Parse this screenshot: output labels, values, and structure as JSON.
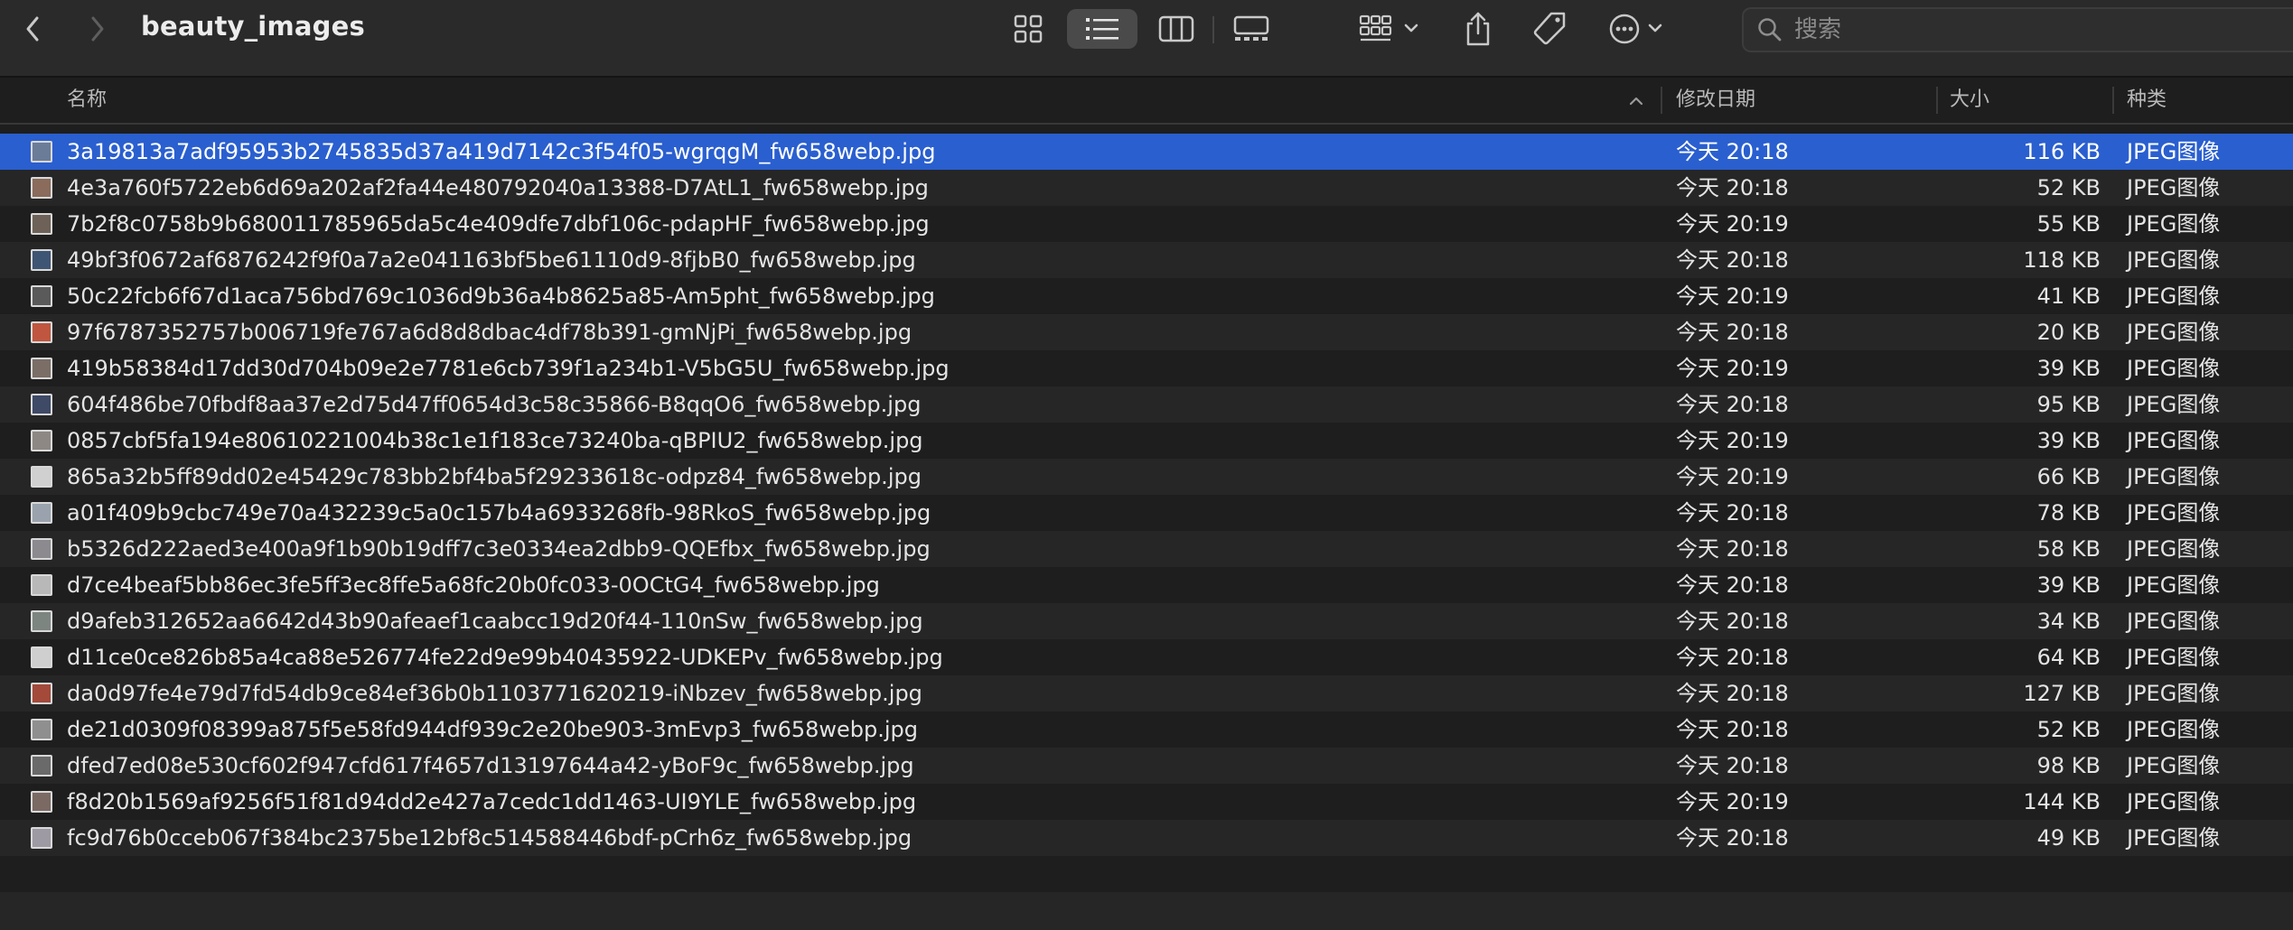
{
  "window": {
    "title": "beauty_images"
  },
  "toolbar": {
    "icons": [
      "chevron-left-icon",
      "chevron-right-icon",
      "icon-view-grid-icon",
      "list-view-icon",
      "column-view-icon",
      "gallery-view-icon",
      "group-icon",
      "share-icon",
      "tag-icon",
      "more-icon"
    ],
    "active_view": "list"
  },
  "search": {
    "placeholder": "搜索",
    "value": ""
  },
  "columns": {
    "name": "名称",
    "date": "修改日期",
    "size": "大小",
    "kind": "种类",
    "sort": "ascending-by-name"
  },
  "colors": {
    "selected_row": "#2a5fcf",
    "background": "#1e1e1e",
    "alt_row": "#262626"
  },
  "files": [
    {
      "name": "3a19813a7adf95953b2745835d37a419d7142c3f54f05-wgrqgM_fw658webp.jpg",
      "date": "今天 20:18",
      "size": "116 KB",
      "kind": "JPEG图像",
      "thumb": "#6b7c99"
    },
    {
      "name": "4e3a760f5722eb6d69a202af2fa44e480792040a13388-D7AtL1_fw658webp.jpg",
      "date": "今天 20:18",
      "size": "52 KB",
      "kind": "JPEG图像",
      "thumb": "#8a6b5c"
    },
    {
      "name": "7b2f8c0758b9b680011785965da5c4e409dfe7dbf106c-pdapHF_fw658webp.jpg",
      "date": "今天 20:19",
      "size": "55 KB",
      "kind": "JPEG图像",
      "thumb": "#6e6258"
    },
    {
      "name": "49bf3f0672af6876242f9f0a7a2e041163bf5be61110d9-8fjbB0_fw658webp.jpg",
      "date": "今天 20:18",
      "size": "118 KB",
      "kind": "JPEG图像",
      "thumb": "#3f5574"
    },
    {
      "name": "50c22fcb6f67d1aca756bd769c1036d9b36a4b8625a85-Am5pht_fw658webp.jpg",
      "date": "今天 20:19",
      "size": "41 KB",
      "kind": "JPEG图像",
      "thumb": "#5a5a5a"
    },
    {
      "name": "97f6787352757b006719fe767a6d8d8dbac4df78b391-gmNjPi_fw658webp.jpg",
      "date": "今天 20:18",
      "size": "20 KB",
      "kind": "JPEG图像",
      "thumb": "#c0563f"
    },
    {
      "name": "419b58384d17dd30d704b09e2e7781e6cb739f1a234b1-V5bG5U_fw658webp.jpg",
      "date": "今天 20:19",
      "size": "39 KB",
      "kind": "JPEG图像",
      "thumb": "#7a6e66"
    },
    {
      "name": "604f486be70fbdf8aa37e2d75d47ff0654d3c58c35866-B8qqO6_fw658webp.jpg",
      "date": "今天 20:18",
      "size": "95 KB",
      "kind": "JPEG图像",
      "thumb": "#3e4a66"
    },
    {
      "name": "0857cbf5fa194e80610221004b38c1e1f183ce73240ba-qBPIU2_fw658webp.jpg",
      "date": "今天 20:19",
      "size": "39 KB",
      "kind": "JPEG图像",
      "thumb": "#8e8884"
    },
    {
      "name": "865a32b5ff89dd02e45429c783bb2bf4ba5f29233618c-odpz84_fw658webp.jpg",
      "date": "今天 20:19",
      "size": "66 KB",
      "kind": "JPEG图像",
      "thumb": "#d0d0d0"
    },
    {
      "name": "a01f409b9cbc749e70a432239c5a0c157b4a6933268fb-98RkoS_fw658webp.jpg",
      "date": "今天 20:18",
      "size": "78 KB",
      "kind": "JPEG图像",
      "thumb": "#9aa3ad"
    },
    {
      "name": "b5326d222aed3e400a9f1b90b19dff7c3e0334ea2dbb9-QQEfbx_fw658webp.jpg",
      "date": "今天 20:18",
      "size": "58 KB",
      "kind": "JPEG图像",
      "thumb": "#8c8a8f"
    },
    {
      "name": "d7ce4beaf5bb86ec3fe5ff3ec8ffe5a68fc20b0fc033-0OCtG4_fw658webp.jpg",
      "date": "今天 20:18",
      "size": "39 KB",
      "kind": "JPEG图像",
      "thumb": "#b8b8b8"
    },
    {
      "name": "d9afeb312652aa6642d43b90afeaef1caabcc19d20f44-110nSw_fw658webp.jpg",
      "date": "今天 20:18",
      "size": "34 KB",
      "kind": "JPEG图像",
      "thumb": "#7d8580"
    },
    {
      "name": "d11ce0ce826b85a4ca88e526774fe22d9e99b40435922-UDKEPv_fw658webp.jpg",
      "date": "今天 20:18",
      "size": "64 KB",
      "kind": "JPEG图像",
      "thumb": "#cfcfcf"
    },
    {
      "name": "da0d97fe4e79d7fd54db9ce84ef36b0b1103771620219-iNbzev_fw658webp.jpg",
      "date": "今天 20:18",
      "size": "127 KB",
      "kind": "JPEG图像",
      "thumb": "#a44a3a"
    },
    {
      "name": "de21d0309f08399a875f5e58fd944df939c2e20be903-3mEvp3_fw658webp.jpg",
      "date": "今天 20:18",
      "size": "52 KB",
      "kind": "JPEG图像",
      "thumb": "#8f8f8f"
    },
    {
      "name": "dfed7ed08e530cf602f947cfd617f4657d13197644a42-yBoF9c_fw658webp.jpg",
      "date": "今天 20:18",
      "size": "98 KB",
      "kind": "JPEG图像",
      "thumb": "#6a6a6a"
    },
    {
      "name": "f8d20b1569af9256f51f81d94dd2e427a7cedc1dd1463-UI9YLE_fw658webp.jpg",
      "date": "今天 20:19",
      "size": "144 KB",
      "kind": "JPEG图像",
      "thumb": "#7b6a63"
    },
    {
      "name": "fc9d76b0cceb067f384bc2375be12bf8c514588446bdf-pCrh6z_fw658webp.jpg",
      "date": "今天 20:18",
      "size": "49 KB",
      "kind": "JPEG图像",
      "thumb": "#9e9aa3"
    }
  ],
  "selected_index": 0
}
